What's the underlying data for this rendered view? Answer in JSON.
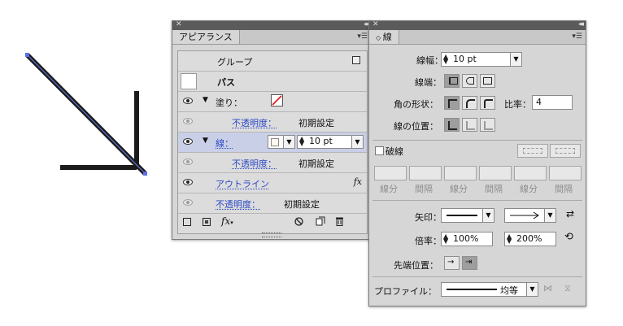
{
  "appearance_panel": {
    "tab": "アピアランス",
    "group_label": "グループ",
    "path_label": "パス",
    "fill_label": "塗り：",
    "opacity_label": "不透明度：",
    "default_label": "初期設定",
    "stroke_label": "線：",
    "stroke_value": "10 pt",
    "outline_label": "アウトライン",
    "fx_label": "fx"
  },
  "stroke_panel": {
    "tab": "線",
    "weight_label": "線幅：",
    "weight_value": "10 pt",
    "cap_label": "線端：",
    "corner_label": "角の形状：",
    "miter_label": "比率：",
    "miter_value": "4",
    "align_label": "線の位置：",
    "dashed_label": "破線",
    "dash_labels": [
      "線分",
      "間隔",
      "線分",
      "間隔",
      "線分",
      "間隔"
    ],
    "arrow_label": "矢印：",
    "scale_label": "倍率：",
    "scale_start": "100%",
    "scale_end": "200%",
    "align_tip_label": "先端位置：",
    "profile_label": "プロファイル：",
    "profile_value": "均等"
  },
  "colors": {
    "accent_blue": "#2b49c7",
    "selection_row": "#c9cfe6",
    "fill_none_red": "#e02020"
  }
}
